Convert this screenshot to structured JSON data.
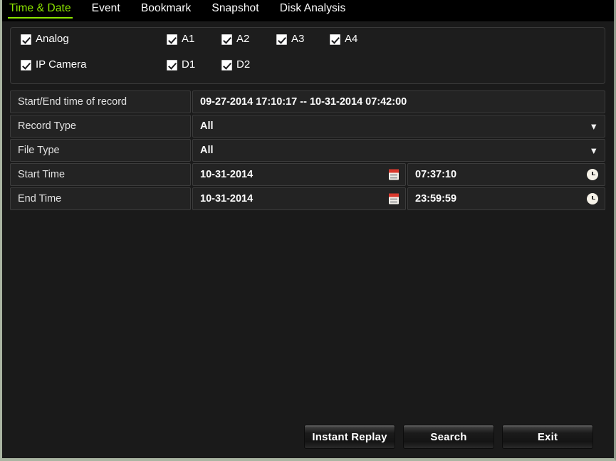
{
  "tabs": [
    {
      "label": "Time & Date",
      "active": true
    },
    {
      "label": "Event",
      "active": false
    },
    {
      "label": "Bookmark",
      "active": false
    },
    {
      "label": "Snapshot",
      "active": false
    },
    {
      "label": "Disk Analysis",
      "active": false
    }
  ],
  "cameras": {
    "analog": {
      "group_label": "Analog",
      "group_checked": true,
      "channels": [
        {
          "label": "A1",
          "checked": true
        },
        {
          "label": "A2",
          "checked": true
        },
        {
          "label": "A3",
          "checked": true
        },
        {
          "label": "A4",
          "checked": true
        }
      ]
    },
    "ip": {
      "group_label": "IP Camera",
      "group_checked": true,
      "channels": [
        {
          "label": "D1",
          "checked": true
        },
        {
          "label": "D2",
          "checked": true
        }
      ]
    }
  },
  "fields": {
    "record_range": {
      "label": "Start/End time of record",
      "value": "09-27-2014 17:10:17 -- 10-31-2014 07:42:00"
    },
    "record_type": {
      "label": "Record Type",
      "value": "All",
      "options": [
        "All"
      ]
    },
    "file_type": {
      "label": "File Type",
      "value": "All",
      "options": [
        "All"
      ]
    },
    "start_time": {
      "label": "Start Time",
      "date": "10-31-2014",
      "time": "07:37:10"
    },
    "end_time": {
      "label": "End Time",
      "date": "10-31-2014",
      "time": "23:59:59"
    }
  },
  "icons": {
    "chevron_down": "⌄",
    "calendar": "calendar-icon",
    "clock": "clock-icon"
  },
  "buttons": {
    "instant_replay": "Instant Replay",
    "search": "Search",
    "exit": "Exit"
  },
  "colors": {
    "accent_green": "#8ce600",
    "panel_bg": "#1d1d1d",
    "field_bg": "#232323",
    "calendar_red": "#d8382c"
  }
}
